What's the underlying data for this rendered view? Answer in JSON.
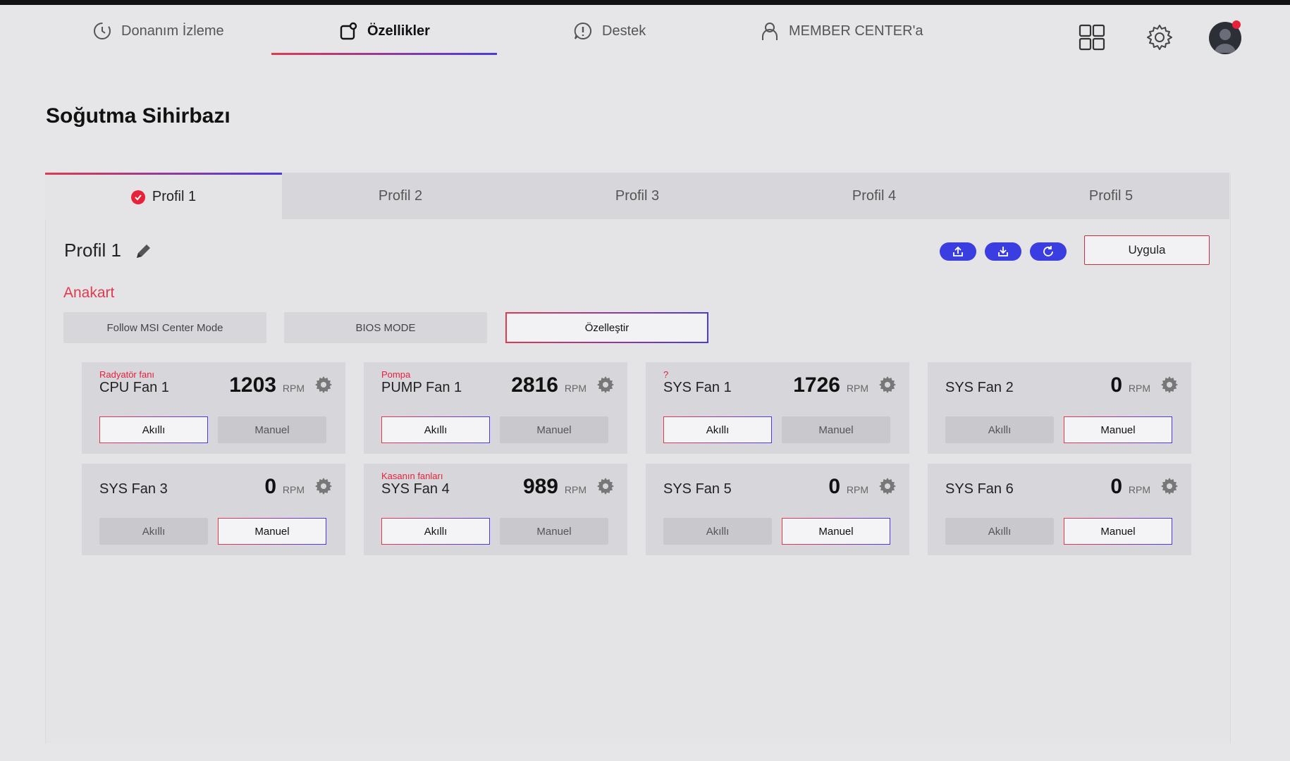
{
  "nav": {
    "items": [
      {
        "label": "Donanım İzleme",
        "icon": "clock-icon"
      },
      {
        "label": "Özellikler",
        "icon": "features-icon",
        "active": true
      },
      {
        "label": "Destek",
        "icon": "support-icon"
      },
      {
        "label": "MEMBER CENTER'a",
        "icon": "member-icon"
      }
    ]
  },
  "page": {
    "title": "Soğutma Sihirbazı"
  },
  "tabs": [
    "Profil 1",
    "Profil 2",
    "Profil 3",
    "Profil 4",
    "Profil 5"
  ],
  "active_tab": "Profil 1",
  "profile": {
    "name": "Profil 1",
    "apply_label": "Uygula",
    "section_label": "Anakart"
  },
  "modes": {
    "follow": "Follow MSI Center Mode",
    "bios": "BIOS MODE",
    "custom": "Özelleştir",
    "selected": "Özelleştir"
  },
  "colors": {
    "accent_red": "#e03a4e",
    "accent_blue": "#3a3de0",
    "notify": "#e8203a"
  },
  "fans": [
    {
      "tag": "Radyatör fanı",
      "name": "CPU Fan 1",
      "rpm": "1203",
      "unit": "RPM",
      "smart": "Akıllı",
      "manual": "Manuel",
      "mode": "smart"
    },
    {
      "tag": "Pompa",
      "name": "PUMP Fan 1",
      "rpm": "2816",
      "unit": "RPM",
      "smart": "Akıllı",
      "manual": "Manuel",
      "mode": "smart"
    },
    {
      "tag": "?",
      "name": "SYS Fan 1",
      "rpm": "1726",
      "unit": "RPM",
      "smart": "Akıllı",
      "manual": "Manuel",
      "mode": "smart"
    },
    {
      "tag": "",
      "name": "SYS Fan 2",
      "rpm": "0",
      "unit": "RPM",
      "smart": "Akıllı",
      "manual": "Manuel",
      "mode": "manual"
    },
    {
      "tag": "",
      "name": "SYS Fan 3",
      "rpm": "0",
      "unit": "RPM",
      "smart": "Akıllı",
      "manual": "Manuel",
      "mode": "manual"
    },
    {
      "tag": "Kasanın fanları",
      "name": "SYS Fan 4",
      "rpm": "989",
      "unit": "RPM",
      "smart": "Akıllı",
      "manual": "Manuel",
      "mode": "smart"
    },
    {
      "tag": "",
      "name": "SYS Fan 5",
      "rpm": "0",
      "unit": "RPM",
      "smart": "Akıllı",
      "manual": "Manuel",
      "mode": "manual"
    },
    {
      "tag": "",
      "name": "SYS Fan 6",
      "rpm": "0",
      "unit": "RPM",
      "smart": "Akıllı",
      "manual": "Manuel",
      "mode": "manual"
    }
  ]
}
